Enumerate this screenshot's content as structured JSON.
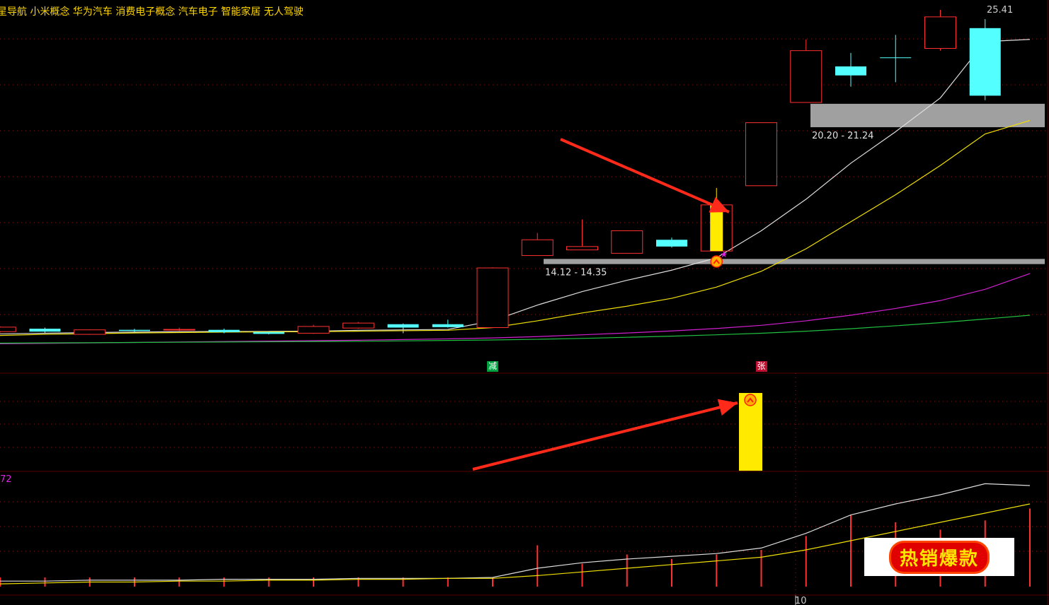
{
  "header": {
    "concepts": "星导航 小米概念 华为汽车 消费电子概念 汽车电子 智能家居 无人驾驶"
  },
  "chart_data": {
    "type": "candlestick",
    "price_max_label": "25.41",
    "zones": [
      {
        "label": "14.12 - 14.35",
        "low": 14.12,
        "high": 14.35
      },
      {
        "label": "20.20 - 21.24",
        "low": 20.2,
        "high": 21.24
      }
    ],
    "candles": [
      {
        "o": 11.12,
        "c": 11.18,
        "h": 11.2,
        "l": 11.0,
        "up": true
      },
      {
        "o": 11.12,
        "c": 11.32,
        "h": 11.35,
        "l": 11.08,
        "up": true
      },
      {
        "o": 11.25,
        "c": 11.12,
        "h": 11.3,
        "l": 11.05,
        "up": false
      },
      {
        "o": 11.0,
        "c": 11.2,
        "h": 11.22,
        "l": 10.98,
        "up": true
      },
      {
        "o": 11.2,
        "c": 11.15,
        "h": 11.25,
        "l": 11.1,
        "up": false
      },
      {
        "o": 11.2,
        "c": 11.22,
        "h": 11.3,
        "l": 11.15,
        "up": true
      },
      {
        "o": 11.2,
        "c": 11.1,
        "h": 11.25,
        "l": 11.05,
        "up": false
      },
      {
        "o": 11.1,
        "c": 11.02,
        "h": 11.15,
        "l": 11.0,
        "up": false
      },
      {
        "o": 11.05,
        "c": 11.35,
        "h": 11.42,
        "l": 11.02,
        "up": true
      },
      {
        "o": 11.28,
        "c": 11.5,
        "h": 11.55,
        "l": 11.25,
        "up": true
      },
      {
        "o": 11.45,
        "c": 11.3,
        "h": 11.48,
        "l": 11.05,
        "up": false
      },
      {
        "o": 11.45,
        "c": 11.32,
        "h": 11.65,
        "l": 11.3,
        "up": false
      },
      {
        "o": 11.3,
        "c": 13.95,
        "h": 13.98,
        "l": 11.3,
        "up": true
      },
      {
        "o": 14.5,
        "c": 15.2,
        "h": 15.5,
        "l": 14.5,
        "up": true
      },
      {
        "o": 14.75,
        "c": 14.9,
        "h": 16.1,
        "l": 14.75,
        "up": true
      },
      {
        "o": 14.6,
        "c": 15.6,
        "h": 15.62,
        "l": 14.6,
        "up": true
      },
      {
        "o": 15.2,
        "c": 14.9,
        "h": 15.3,
        "l": 14.85,
        "up": false
      },
      {
        "o": 14.7,
        "c": 16.75,
        "h": 17.5,
        "l": 14.7,
        "up": true,
        "highlight": true
      },
      {
        "o": 17.6,
        "c": 20.4,
        "h": 20.42,
        "l": 17.6,
        "up": true
      },
      {
        "o": 21.3,
        "c": 23.6,
        "h": 24.1,
        "l": 21.3,
        "up": true
      },
      {
        "o": 22.9,
        "c": 22.5,
        "h": 23.5,
        "l": 22.0,
        "up": false
      },
      {
        "o": 23.3,
        "c": 23.3,
        "h": 24.3,
        "l": 22.2,
        "up": false
      },
      {
        "o": 23.7,
        "c": 25.1,
        "h": 25.41,
        "l": 23.6,
        "up": true
      },
      {
        "o": 24.6,
        "c": 21.6,
        "h": 25.0,
        "l": 21.4,
        "up": false
      }
    ],
    "ma_series": [
      {
        "color": "#dddddd",
        "values": [
          11.0,
          11.02,
          11.05,
          11.08,
          11.1,
          11.12,
          11.13,
          11.13,
          11.14,
          11.18,
          11.2,
          11.22,
          11.6,
          12.3,
          12.9,
          13.4,
          13.85,
          14.4,
          15.6,
          17.0,
          18.6,
          20.0,
          21.5,
          24.0,
          24.1
        ]
      },
      {
        "color": "#f0e000",
        "values": [
          10.9,
          10.95,
          11.0,
          11.03,
          11.06,
          11.08,
          11.1,
          11.11,
          11.12,
          11.14,
          11.16,
          11.18,
          11.3,
          11.6,
          11.95,
          12.25,
          12.6,
          13.1,
          13.8,
          14.8,
          16.0,
          17.2,
          18.5,
          19.9,
          20.5
        ]
      },
      {
        "color": "#d020d0",
        "values": [
          10.55,
          10.58,
          10.6,
          10.62,
          10.64,
          10.66,
          10.68,
          10.7,
          10.72,
          10.74,
          10.77,
          10.8,
          10.84,
          10.9,
          10.98,
          11.06,
          11.15,
          11.26,
          11.4,
          11.6,
          11.85,
          12.15,
          12.5,
          13.0,
          13.7
        ]
      },
      {
        "color": "#20c040",
        "values": [
          10.6,
          10.61,
          10.62,
          10.63,
          10.64,
          10.65,
          10.66,
          10.67,
          10.68,
          10.69,
          10.71,
          10.73,
          10.75,
          10.78,
          10.82,
          10.87,
          10.92,
          10.98,
          11.05,
          11.14,
          11.25,
          11.38,
          11.52,
          11.68,
          11.85
        ]
      }
    ],
    "signals": [
      {
        "label": "减",
        "index": 12,
        "color": "#00a040"
      },
      {
        "label": "张",
        "index": 18,
        "color": "#c01030"
      }
    ],
    "indicator_label": "72",
    "volume": [
      0.1,
      0.1,
      0.1,
      0.1,
      0.1,
      0.1,
      0.1,
      0.1,
      0.1,
      0.1,
      0.1,
      0.1,
      0.1,
      0.45,
      0.25,
      0.35,
      0.3,
      0.35,
      0.4,
      0.55,
      0.78,
      0.7,
      0.62,
      0.72,
      0.85
    ],
    "vol_ma_white": [
      0.05,
      0.06,
      0.06,
      0.07,
      0.07,
      0.07,
      0.08,
      0.08,
      0.08,
      0.09,
      0.09,
      0.09,
      0.1,
      0.2,
      0.26,
      0.3,
      0.33,
      0.36,
      0.42,
      0.58,
      0.78,
      0.9,
      1.0,
      1.12,
      1.1
    ],
    "vol_ma_yellow": [
      0.02,
      0.03,
      0.04,
      0.05,
      0.05,
      0.06,
      0.06,
      0.07,
      0.07,
      0.08,
      0.08,
      0.09,
      0.09,
      0.12,
      0.16,
      0.2,
      0.24,
      0.28,
      0.32,
      0.4,
      0.5,
      0.6,
      0.7,
      0.8,
      0.9
    ],
    "date_label": "10",
    "stamp": "热销爆款"
  }
}
